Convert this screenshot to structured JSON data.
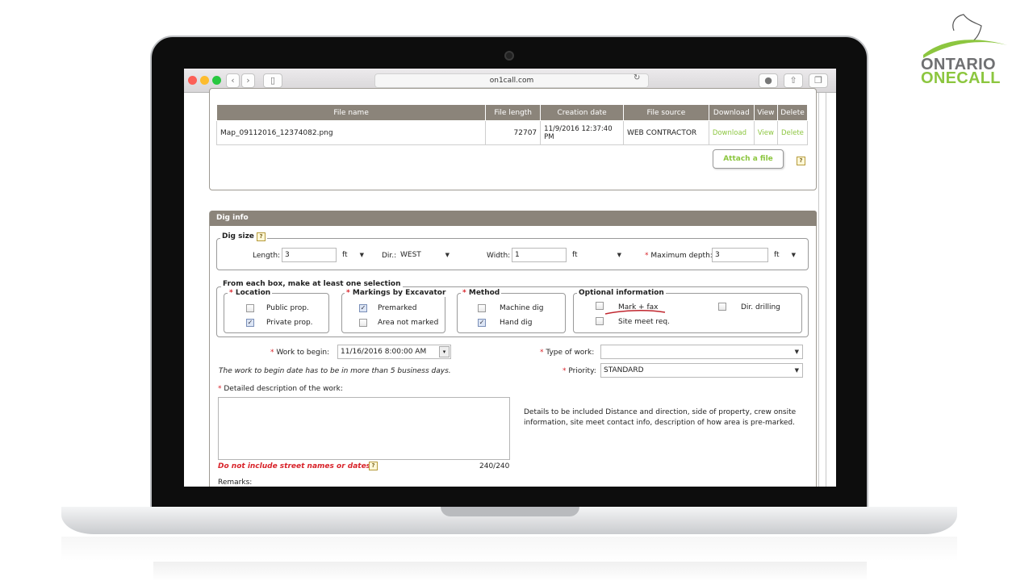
{
  "browser": {
    "url": "on1call.com"
  },
  "logo": {
    "line1": "ONTARIO",
    "line2": "ONECALL"
  },
  "files_table": {
    "headers": [
      "File name",
      "File length",
      "Creation date",
      "File source",
      "Download",
      "View",
      "Delete"
    ],
    "rows": [
      {
        "file_name": "Map_09112016_12374082.png",
        "file_length": "72707",
        "creation_date": "11/9/2016 12:37:40 PM",
        "file_source": "WEB CONTRACTOR",
        "download": "Download",
        "view": "View",
        "delete": "Delete"
      }
    ],
    "attach_label": "Attach a file",
    "help": "?"
  },
  "dig_info": {
    "header": "Dig info",
    "dig_size": {
      "legend": "Dig size",
      "length_label": "Length:",
      "length_value": "3",
      "length_unit": "ft",
      "dir_label": "Dir.:",
      "dir_value": "WEST",
      "width_label": "Width:",
      "width_value": "1",
      "width_unit": "ft",
      "max_depth_label": "Maximum depth:",
      "max_depth_value": "3",
      "max_depth_unit": "ft"
    },
    "selection_note": "From each box, make at least one selection",
    "location": {
      "legend": "Location",
      "options": [
        {
          "label": "Public prop.",
          "checked": false
        },
        {
          "label": "Private prop.",
          "checked": true
        }
      ]
    },
    "markings": {
      "legend": "Markings by Excavator",
      "options": [
        {
          "label": "Premarked",
          "checked": true
        },
        {
          "label": "Area not marked",
          "checked": false
        }
      ]
    },
    "method": {
      "legend": "Method",
      "options": [
        {
          "label": "Machine dig",
          "checked": false
        },
        {
          "label": "Hand dig",
          "checked": true
        }
      ]
    },
    "optional": {
      "legend": "Optional information",
      "options": [
        {
          "label": "Mark + fax",
          "checked": false
        },
        {
          "label": "Dir. drilling",
          "checked": false
        },
        {
          "label": "Site meet req.",
          "checked": false
        }
      ]
    },
    "work_to_begin_label": "Work to begin:",
    "work_to_begin_value": "11/16/2016 8:00:00 AM",
    "work_to_begin_note": "The work to begin date has to be in more than 5 business days.",
    "type_of_work_label": "Type of work:",
    "type_of_work_value": "",
    "priority_label": "Priority:",
    "priority_value": "STANDARD",
    "description_label": "Detailed description of the work:",
    "description_value": "",
    "details_hint": "Details to be included Distance and direction, side of property, crew onsite information, site meet contact info, description of how area is pre-marked.",
    "warning": "Do not include street names or dates",
    "char_count": "240/240",
    "remarks_label": "Remarks:"
  },
  "colors": {
    "header_brown": "#8b847a",
    "accent_green": "#8cc63f",
    "required_red": "#d8232a"
  }
}
